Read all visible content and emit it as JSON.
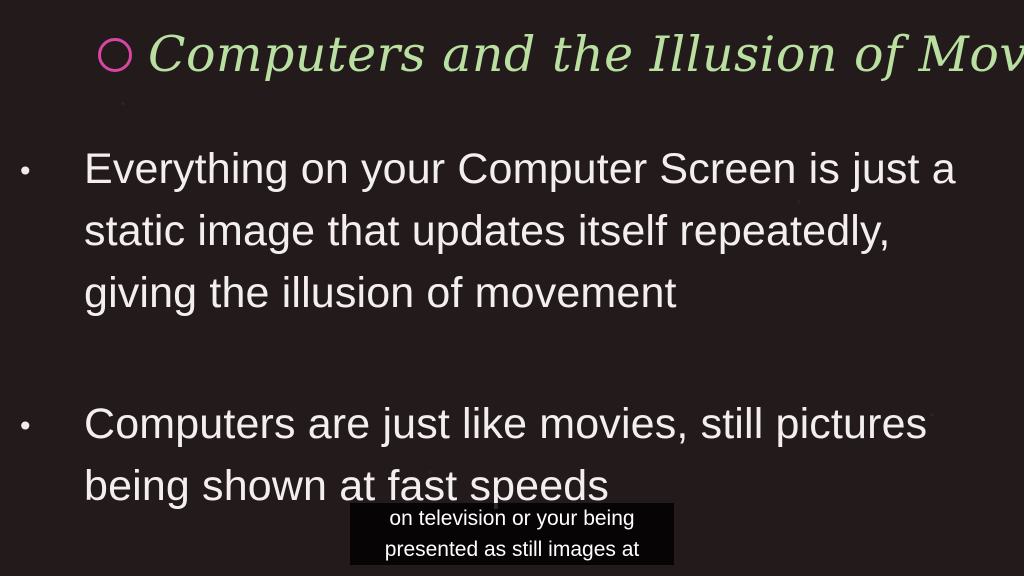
{
  "slide": {
    "title": "Computers and the Illusion of Movement",
    "bullets": [
      {
        "lines": [
          "Everything on your Computer Screen is just a",
          "static image that updates itself repeatedly,",
          "giving the illusion of movement"
        ]
      },
      {
        "lines": [
          "Computers are just like movies, still pictures",
          "being shown at fast speeds"
        ]
      }
    ],
    "bullet_symbol": "•"
  },
  "captions": {
    "lines": [
      "on television or your being",
      "presented as still images at"
    ]
  },
  "colors": {
    "background": "#231b1b",
    "title": "#b9e0a1",
    "accent_circle": "#d846a1",
    "body_text": "#f2efee",
    "caption_background": "#000000",
    "caption_text": "#ffffff"
  },
  "icons": {
    "title_marker": "circle-outline-icon",
    "bullet_marker": "bullet-dot-icon"
  }
}
